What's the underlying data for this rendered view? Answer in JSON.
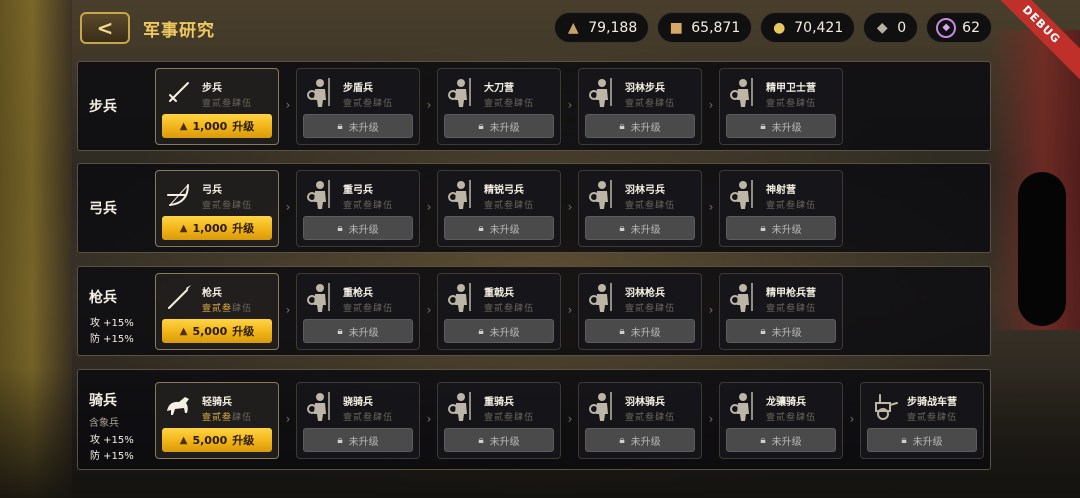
{
  "header": {
    "title": "军事研究",
    "back_label": "<",
    "debug_label": "DEBUG"
  },
  "resources": [
    {
      "icon": "food-icon",
      "value": "79,188"
    },
    {
      "icon": "wood-icon",
      "value": "65,871"
    },
    {
      "icon": "gold-icon",
      "value": "70,421"
    },
    {
      "icon": "ore-icon",
      "value": "0"
    },
    {
      "icon": "gem-icon",
      "value": "62"
    }
  ],
  "rows": [
    {
      "label": "步兵",
      "sub": "",
      "bonus_atk": "",
      "bonus_def": "",
      "cards": [
        {
          "name": "步兵",
          "tier": "壹贰叁肆伍",
          "unlocked_tiers": 0,
          "active": true,
          "action": "1,000",
          "action_suffix": "升级"
        },
        {
          "name": "步盾兵",
          "tier": "壹贰叁肆伍",
          "unlocked_tiers": 0,
          "active": false,
          "action": "未升级"
        },
        {
          "name": "大刀营",
          "tier": "壹贰叁肆伍",
          "unlocked_tiers": 0,
          "active": false,
          "action": "未升级"
        },
        {
          "name": "羽林步兵",
          "tier": "壹贰叁肆伍",
          "unlocked_tiers": 0,
          "active": false,
          "action": "未升级"
        },
        {
          "name": "精甲卫士营",
          "tier": "壹贰叁肆伍",
          "unlocked_tiers": 0,
          "active": false,
          "action": "未升级"
        }
      ]
    },
    {
      "label": "弓兵",
      "sub": "",
      "bonus_atk": "",
      "bonus_def": "",
      "cards": [
        {
          "name": "弓兵",
          "tier": "壹贰叁肆伍",
          "unlocked_tiers": 0,
          "active": true,
          "action": "1,000",
          "action_suffix": "升级"
        },
        {
          "name": "重弓兵",
          "tier": "壹贰叁肆伍",
          "unlocked_tiers": 0,
          "active": false,
          "action": "未升级"
        },
        {
          "name": "精锐弓兵",
          "tier": "壹贰叁肆伍",
          "unlocked_tiers": 0,
          "active": false,
          "action": "未升级"
        },
        {
          "name": "羽林弓兵",
          "tier": "壹贰叁肆伍",
          "unlocked_tiers": 0,
          "active": false,
          "action": "未升级"
        },
        {
          "name": "神射营",
          "tier": "壹贰叁肆伍",
          "unlocked_tiers": 0,
          "active": false,
          "action": "未升级"
        }
      ]
    },
    {
      "label": "枪兵",
      "sub": "",
      "bonus_atk": "攻 +15%",
      "bonus_def": "防 +15%",
      "cards": [
        {
          "name": "枪兵",
          "tier": "壹贰叁肆伍",
          "unlocked_tiers": 3,
          "active": true,
          "action": "5,000",
          "action_suffix": "升级"
        },
        {
          "name": "重枪兵",
          "tier": "壹贰叁肆伍",
          "unlocked_tiers": 0,
          "active": false,
          "action": "未升级"
        },
        {
          "name": "重戟兵",
          "tier": "壹贰叁肆伍",
          "unlocked_tiers": 0,
          "active": false,
          "action": "未升级"
        },
        {
          "name": "羽林枪兵",
          "tier": "壹贰叁肆伍",
          "unlocked_tiers": 0,
          "active": false,
          "action": "未升级"
        },
        {
          "name": "精甲枪兵营",
          "tier": "壹贰叁肆伍",
          "unlocked_tiers": 0,
          "active": false,
          "action": "未升级"
        }
      ]
    },
    {
      "label": "骑兵",
      "sub": "含象兵",
      "bonus_atk": "攻 +15%",
      "bonus_def": "防 +15%",
      "cards": [
        {
          "name": "轻骑兵",
          "tier": "壹贰叁肆伍",
          "unlocked_tiers": 3,
          "active": true,
          "action": "5,000",
          "action_suffix": "升级"
        },
        {
          "name": "骁骑兵",
          "tier": "壹贰叁肆伍",
          "unlocked_tiers": 0,
          "active": false,
          "action": "未升级"
        },
        {
          "name": "重骑兵",
          "tier": "壹贰叁肆伍",
          "unlocked_tiers": 0,
          "active": false,
          "action": "未升级"
        },
        {
          "name": "羽林骑兵",
          "tier": "壹贰叁肆伍",
          "unlocked_tiers": 0,
          "active": false,
          "action": "未升级"
        },
        {
          "name": "龙骧骑兵",
          "tier": "壹贰叁肆伍",
          "unlocked_tiers": 0,
          "active": false,
          "action": "未升级"
        },
        {
          "name": "步骑战车营",
          "tier": "壹贰叁肆伍",
          "unlocked_tiers": 0,
          "active": false,
          "action": "未升级"
        }
      ]
    }
  ]
}
